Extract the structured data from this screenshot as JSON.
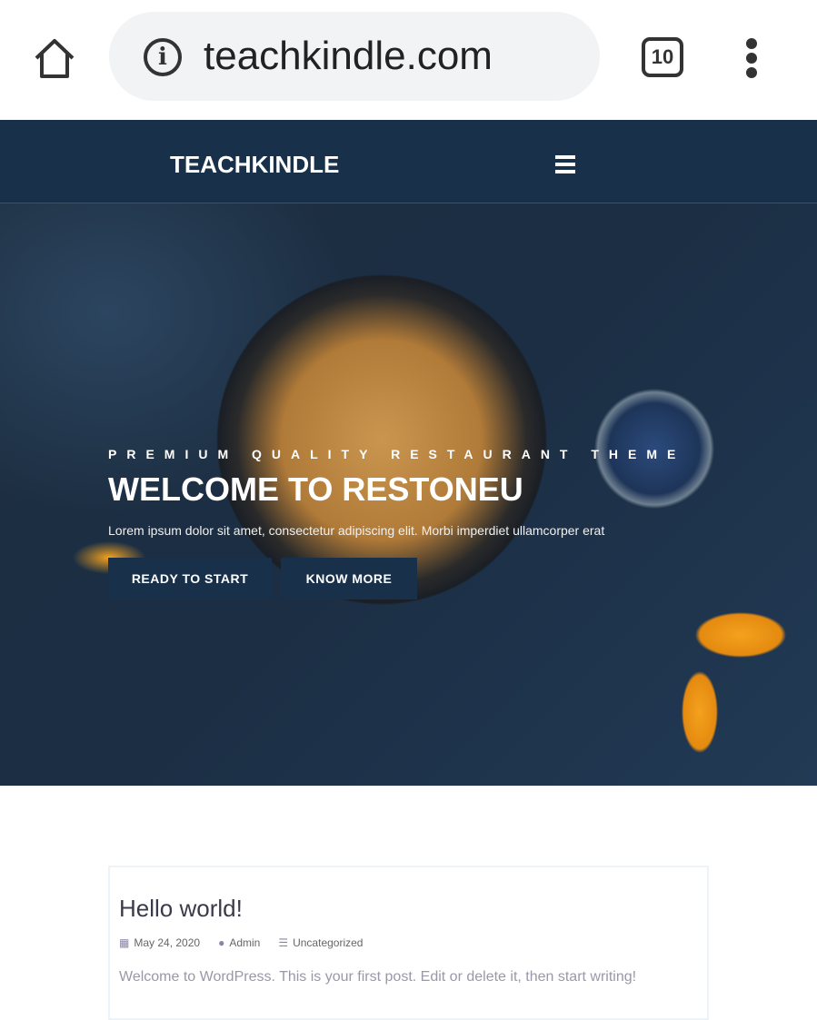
{
  "browser": {
    "url": "teachkindle.com",
    "tab_count": "10"
  },
  "nav": {
    "brand": "TEACHKINDLE"
  },
  "hero": {
    "tagline": "PREMIUM QUALITY RESTAURANT THEME",
    "headline": "WELCOME TO RESTONEU",
    "lead": "Lorem ipsum dolor sit amet, consectetur adipiscing elit. Morbi imperdiet ullamcorper erat",
    "button_primary": "READY TO START",
    "button_secondary": "KNOW MORE"
  },
  "post": {
    "title": "Hello world!",
    "date": "May 24, 2020",
    "author": "Admin",
    "category": "Uncategorized",
    "excerpt": "Welcome to WordPress. This is your first post. Edit or delete it, then start writing!"
  }
}
